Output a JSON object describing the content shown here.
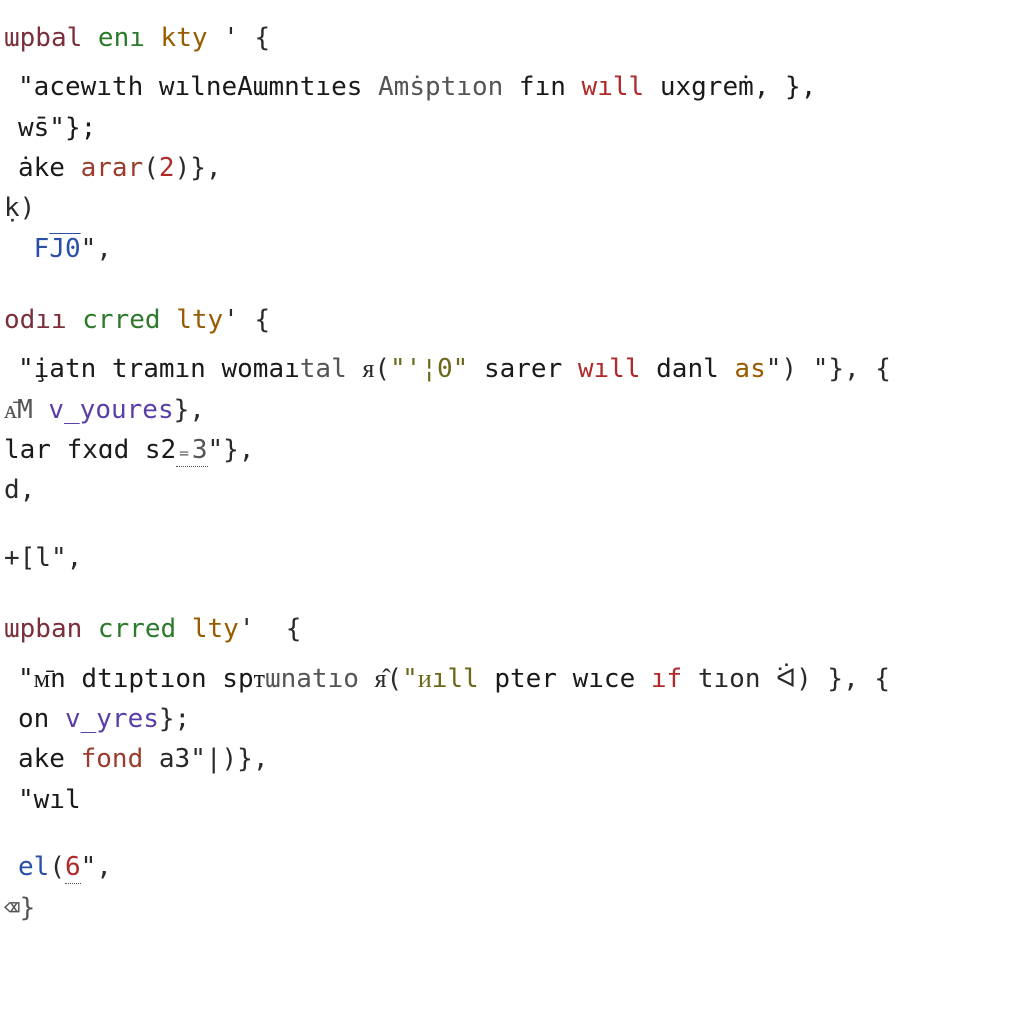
{
  "blocks": [
    {
      "head": {
        "kw1": "ɯpbal",
        "kw2": "enı",
        "ident": "kty",
        "tail": " ' {"
      },
      "lines": [
        {
          "segs": [
            {
              "t": "\"acewıth wılneAɯmntıes ",
              "c": "str"
            },
            {
              "t": "Amṡptıon",
              "c": "muted"
            },
            {
              "t": " fın ",
              "c": "str"
            },
            {
              "t": "wıll",
              "c": "red"
            },
            {
              "t": " uxgreṁ, },",
              "c": "str"
            }
          ],
          "sub": true
        },
        {
          "segs": [
            {
              "t": "ws̄\"};",
              "c": "str"
            }
          ],
          "sub": true
        },
        {
          "segs": [
            {
              "t": "ȧke ",
              "c": "str"
            },
            {
              "t": "arar",
              "c": "fn"
            },
            {
              "t": "(",
              "c": "punct"
            },
            {
              "t": "2",
              "c": "num"
            },
            {
              "t": ")},",
              "c": "punct"
            }
          ],
          "sub": true
        },
        {
          "segs": [
            {
              "t": "ḳ)",
              "c": "punct"
            }
          ]
        },
        {
          "segs": [
            {
              "t": " ",
              "c": "punct"
            },
            {
              "t": "F",
              "c": "call"
            },
            {
              "t": "J0",
              "c": "call",
              "deco": "ol"
            },
            {
              "t": "\",",
              "c": "punct"
            }
          ],
          "sub": true
        }
      ]
    },
    {
      "head": {
        "kw1": "odıı",
        "kw2": "crred",
        "ident": "lty",
        "tail": "' {"
      },
      "lines": [
        {
          "segs": [
            {
              "t": "\"i̧atn tramın womaı",
              "c": "str"
            },
            {
              "t": "tal ",
              "c": "muted"
            },
            {
              "t": "ᴙ(",
              "c": "punct"
            },
            {
              "t": "\"'¦0\"",
              "c": "olive"
            },
            {
              "t": " sarer ",
              "c": "str"
            },
            {
              "t": "wıll",
              "c": "red"
            },
            {
              "t": " danl ",
              "c": "str"
            },
            {
              "t": "as",
              "c": "ident"
            },
            {
              "t": "\") \"}, {",
              "c": "punct"
            }
          ],
          "sub": true
        },
        {
          "segs": [
            {
              "t": "ᴀ̄M ",
              "c": "muted"
            },
            {
              "t": "v_youres",
              "c": "var"
            },
            {
              "t": "},",
              "c": "punct"
            }
          ]
        },
        {
          "segs": [
            {
              "t": "lar fxɑd s2",
              "c": "str"
            },
            {
              "t": "₌3",
              "c": "muted",
              "deco": "udot"
            },
            {
              "t": "\"},",
              "c": "punct"
            }
          ]
        },
        {
          "segs": [
            {
              "t": "d,",
              "c": "punct"
            }
          ]
        },
        {
          "blank": true
        },
        {
          "segs": [
            {
              "t": "+[l\",",
              "c": "punct"
            }
          ]
        }
      ]
    },
    {
      "head": {
        "kw1": "ɯpban",
        "kw2": "crred",
        "ident": "lty",
        "tail": "'  {"
      },
      "lines": [
        {
          "segs": [
            {
              "t": "\"ᴍ̄n dtıptıon spᴛ",
              "c": "str"
            },
            {
              "t": "ɯnatıo ",
              "c": "muted"
            },
            {
              "t": "ᴙ̂(",
              "c": "punct"
            },
            {
              "t": "\"ᴎıll",
              "c": "olive"
            },
            {
              "t": " pter wıce ",
              "c": "str"
            },
            {
              "t": "ıf",
              "c": "red"
            },
            {
              "t": " tıon ᐛ) }, {",
              "c": "punct"
            }
          ],
          "sub": true
        },
        {
          "segs": [
            {
              "t": "on ",
              "c": "str"
            },
            {
              "t": "v_yres",
              "c": "var"
            },
            {
              "t": "};",
              "c": "punct"
            }
          ],
          "sub": true
        },
        {
          "segs": [
            {
              "t": "ake ",
              "c": "str"
            },
            {
              "t": "fond",
              "c": "fn"
            },
            {
              "t": " a3\"|)},",
              "c": "punct"
            }
          ],
          "sub": true
        },
        {
          "segs": [
            {
              "t": "\"wıl",
              "c": "str"
            }
          ],
          "sub": true
        },
        {
          "blank": true
        },
        {
          "segs": [
            {
              "t": "el",
              "c": "call"
            },
            {
              "t": "(",
              "c": "punct"
            },
            {
              "t": "6",
              "c": "num",
              "deco": "udot"
            },
            {
              "t": "\",",
              "c": "punct"
            }
          ],
          "sub": true
        },
        {
          "segs": [
            {
              "t": "⌫}",
              "c": "muted"
            }
          ]
        }
      ]
    }
  ]
}
